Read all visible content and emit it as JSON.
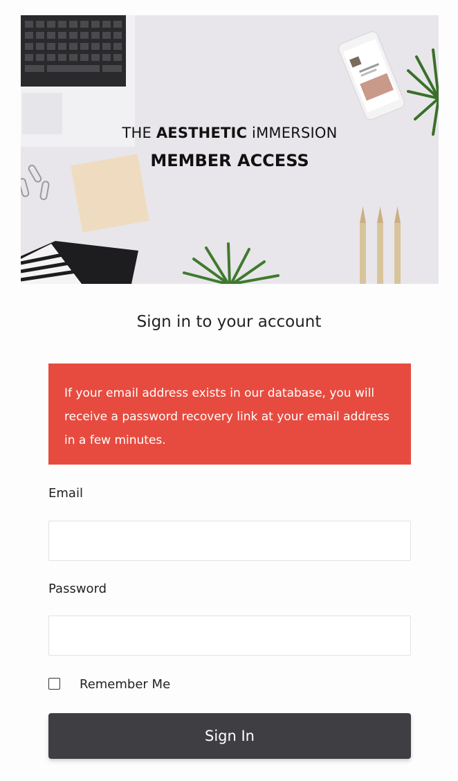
{
  "hero": {
    "line1_prefix": "THE ",
    "line1_strong": "AESTHETIC",
    "line1_suffix": " iMMERSION",
    "line2": "MEMBER ACCESS"
  },
  "heading": "Sign in to your account",
  "alert": {
    "message": "If your email address exists in our database, you will receive a password recovery link at your email address in a few minutes.",
    "color": "#e74b3f"
  },
  "form": {
    "email_label": "Email",
    "email_value": "",
    "password_label": "Password",
    "password_value": "",
    "remember_label": "Remember Me",
    "remember_checked": false,
    "submit_label": "Sign In"
  },
  "colors": {
    "button": "#3f3f43",
    "hero_background": "#e8e6ea"
  }
}
